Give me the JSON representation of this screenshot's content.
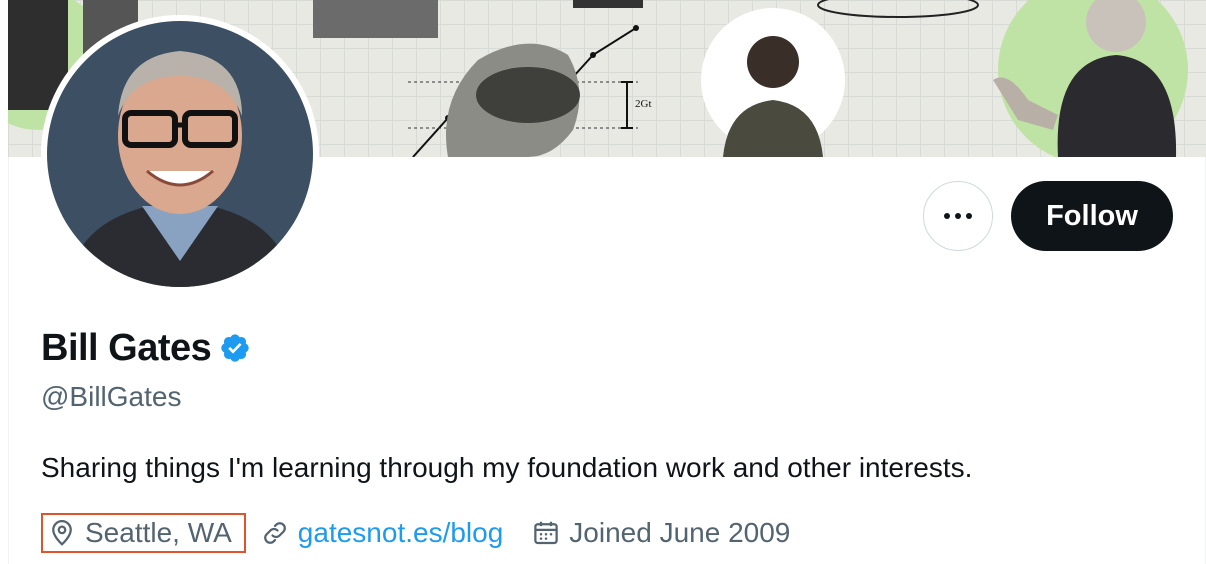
{
  "profile": {
    "display_name": "Bill Gates",
    "verified_badge_icon": "verified-badge-icon",
    "handle": "@BillGates",
    "bio": "Sharing things I'm learning through my foundation work and other interests.",
    "location": "Seattle, WA",
    "website": "gatesnot.es/blog",
    "joined": "Joined June 2009"
  },
  "banner": {
    "annotation_label": "2Gt"
  },
  "actions": {
    "more_icon": "more-horizontal-icon",
    "follow_label": "Follow"
  },
  "colors": {
    "primary_text": "#0f1419",
    "secondary_text": "#536471",
    "link": "#1d9bf0",
    "verified_blue": "#1d9bf0",
    "follow_bg": "#0f1419",
    "highlight_border": "#e0532b",
    "banner_green": "#bfe3a4"
  }
}
